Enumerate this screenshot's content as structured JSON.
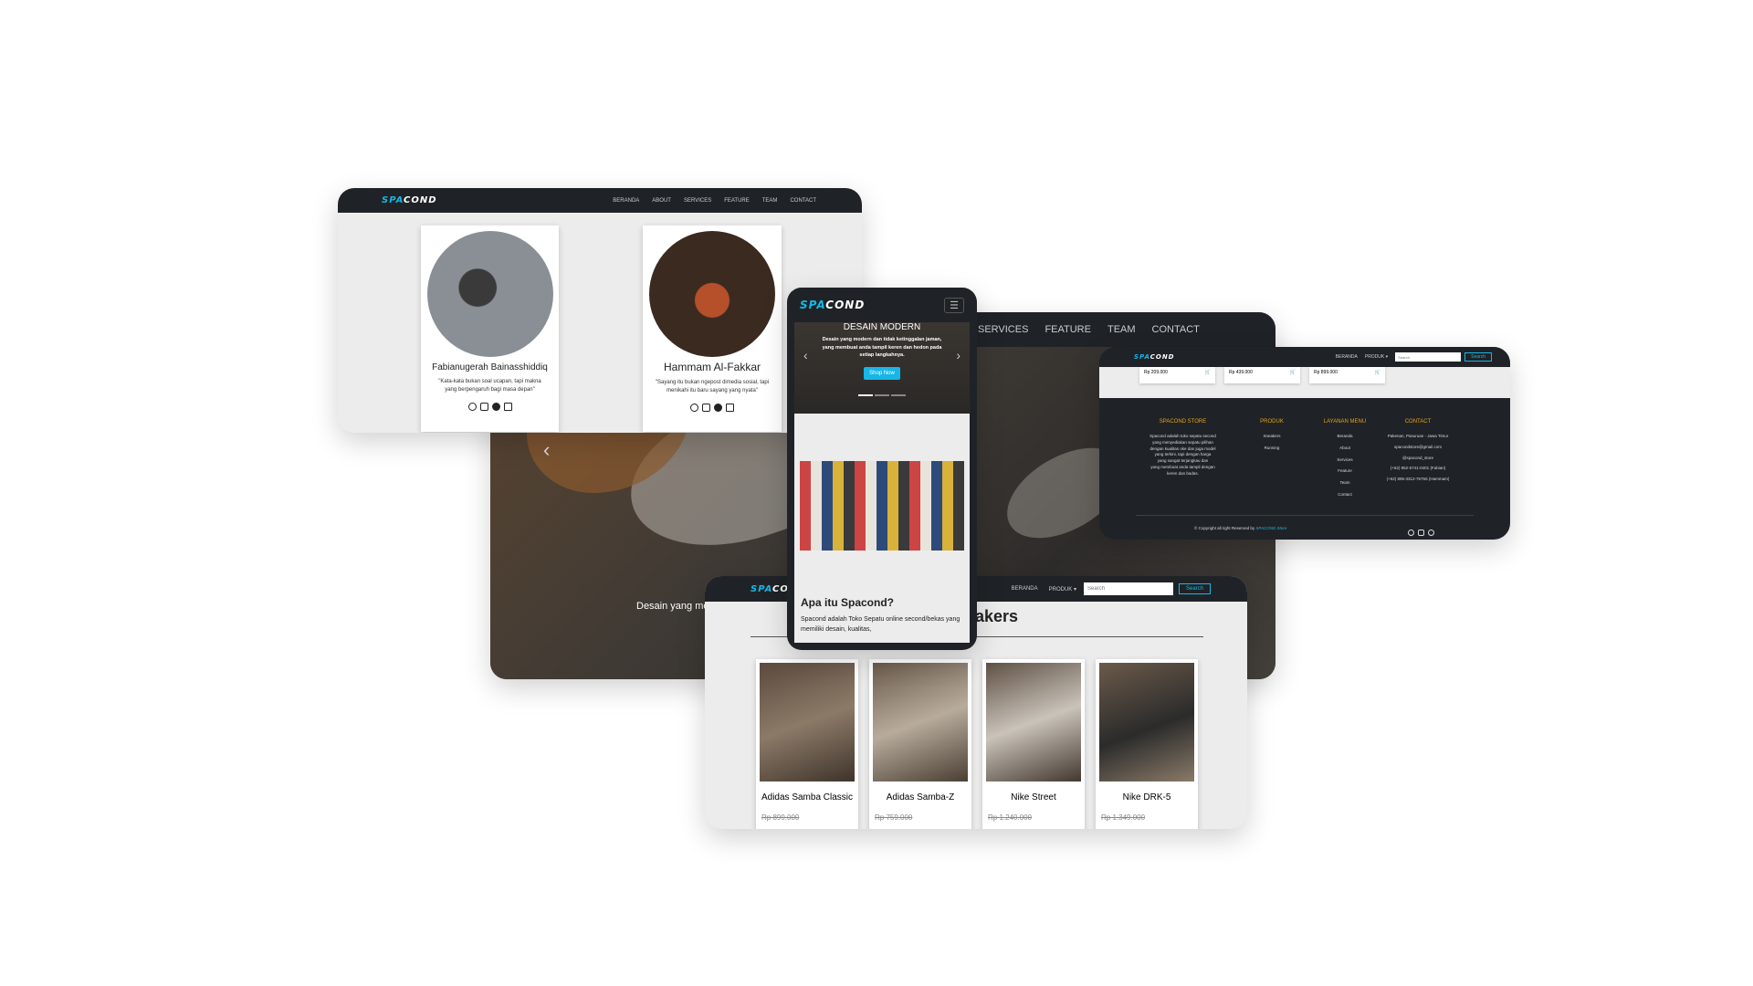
{
  "brand": {
    "part1": "SPA",
    "part2": "COND",
    "accent": "#18b6e6",
    "dark_bg": "#1f2327"
  },
  "team_screen": {
    "nav": [
      "BERANDA",
      "ABOUT",
      "SERVICES",
      "FEATURE",
      "TEAM",
      "CONTACT"
    ],
    "members": [
      {
        "name": "Fabianugerah Bainasshiddiq",
        "quote": "\"Kata-kata bukan soal ucapan, tapi makna yang berpengaruh bagi masa depan\""
      },
      {
        "name": "Hammam Al-Fakkar",
        "quote": "\"Sayang itu bukan ngepost dimedia sosial, tapi menikahi itu baru sayang yang nyata\""
      }
    ]
  },
  "hero_screen": {
    "nav": [
      "SERVICES",
      "FEATURE",
      "TEAM",
      "CONTACT"
    ],
    "caption": "Desain yang mod"
  },
  "mobile_screen": {
    "slide_title": "DESAIN MODERN",
    "slide_text": "Desain yang modern dan tidak ketinggalan jaman, yang membuat anda tampil keren dan hedon pada setiap langkahnya.",
    "cta": "Shop Now",
    "about_title": "Apa itu Spacond?",
    "about_text": "Spacond adalah Toko Sepatu online second/bekas yang memiliki desain, kualitas,"
  },
  "footer_screen": {
    "nav": {
      "beranda": "BERANDA",
      "produk": "PRODUK ▾"
    },
    "search_placeholder": "Search",
    "search_button": "Search",
    "prices": [
      "Rp 209.000",
      "Rp 439.000",
      "Rp 899.000"
    ],
    "columns": [
      {
        "title": "SPACOND STORE",
        "lines": [
          "Spacond adalah toko sepatu second",
          "yang menyediakan sepatu pilihan",
          "dengan kualitas oke dan juga model",
          "yang terkini, tapi dengan harga",
          "yang sangat terjangkau dan",
          "yang membuat anda tampil dengan",
          "keren dan badas."
        ]
      },
      {
        "title": "PRODUK",
        "lines": [
          "Sneakers",
          "Running"
        ]
      },
      {
        "title": "LAYANAN MENU",
        "lines": [
          "Beranda",
          "About",
          "Services",
          "Feature",
          "Team",
          "Contact"
        ]
      },
      {
        "title": "CONTACT",
        "lines": [
          "Pakenan, Pasuruan - Jawa Timur",
          "spacondstore@gmail.com",
          "@spacond_store",
          "(+62) 852-5741-0401 (Fabian)",
          "(+62) 895-3312-76755 (Hammam)"
        ]
      }
    ],
    "copyright_prefix": "© Copyright all right Reserved by",
    "copyright_brand": "SPACOND Store",
    "title_color": "#e0a31e"
  },
  "products_screen": {
    "nav": {
      "beranda": "BERANDA",
      "produk": "PRODUK ▾"
    },
    "search_placeholder": "Search",
    "search_button": "Search",
    "heading_fragment": "akers",
    "products": [
      {
        "name": "Adidas Samba Classic",
        "old_price": "Rp 899.000"
      },
      {
        "name": "Adidas Samba-Z",
        "old_price": "Rp 759.000"
      },
      {
        "name": "Nike Street",
        "old_price": "Rp 1.240.000"
      },
      {
        "name": "Nike DRK-5",
        "old_price": "Rp 1.349.000"
      }
    ]
  }
}
